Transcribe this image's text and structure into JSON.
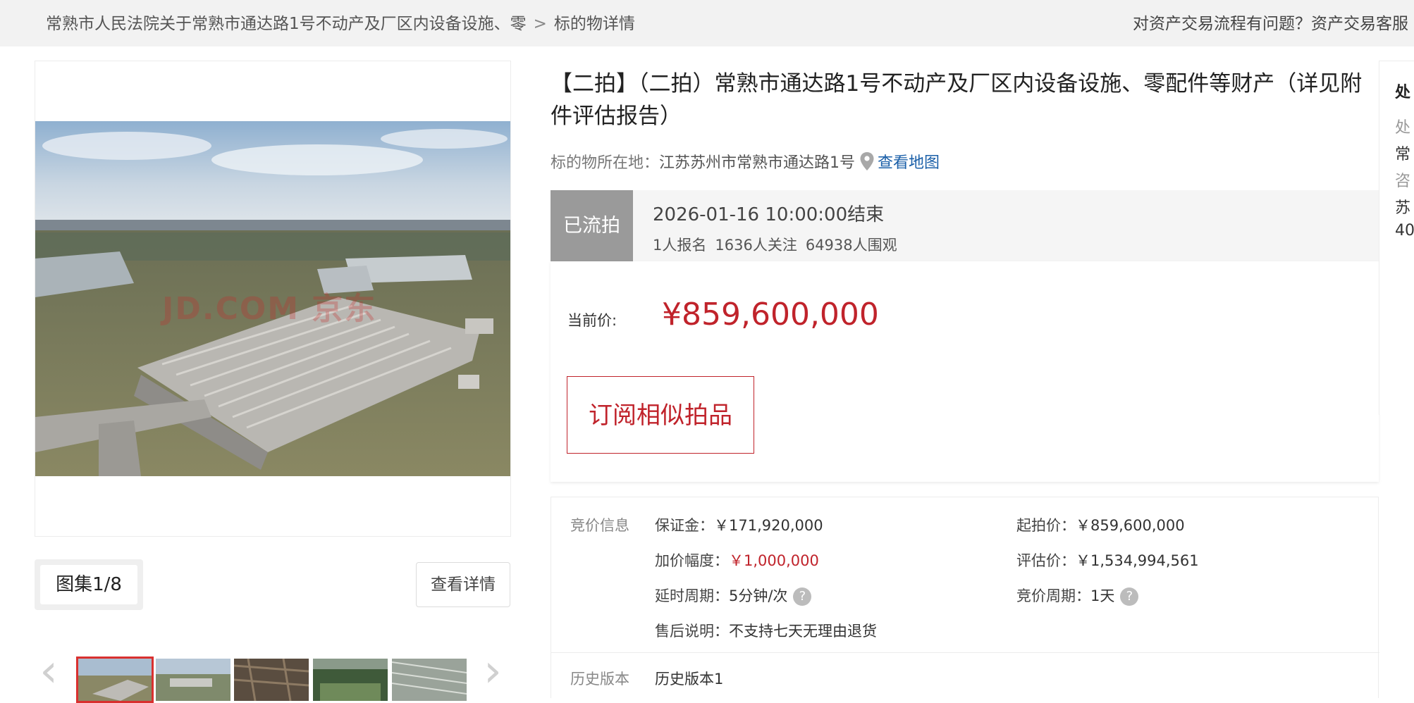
{
  "breadcrumb": {
    "court": "常熟市人民法院关于常熟市通达路1号不动产及厂区内设备设施、零",
    "separator": ">",
    "current": "标的物详情"
  },
  "help_text": "对资产交易流程有问题？资产交易客服",
  "gallery": {
    "watermark": "JD.COM 京东",
    "album_label": "图集1/8",
    "detail_button": "查看详情",
    "prev_icon": "chevron-left-icon",
    "next_icon": "chevron-right-icon"
  },
  "item": {
    "title": "【二拍】（二拍）常熟市通达路1号不动产及厂区内设备设施、零配件等财产（详见附件评估报告）",
    "location_label": "标的物所在地：",
    "location": "江苏苏州市常熟市通达路1号",
    "map_link": "查看地图"
  },
  "status": {
    "badge": "已流拍",
    "end_time": "2026-01-16 10:00:00结束",
    "signups": "1人报名",
    "followers": "1636人关注",
    "viewers": "64938人围观"
  },
  "price": {
    "label": "当前价:",
    "value": "¥859,600,000",
    "subscribe_button": "订阅相似拍品"
  },
  "bid_info": {
    "section_label": "竞价信息",
    "deposit_label": "保证金：",
    "deposit_value": "￥171,920,000",
    "start_price_label": "起拍价：",
    "start_price_value": "￥859,600,000",
    "increment_label": "加价幅度：",
    "increment_value": "￥1,000,000",
    "appraisal_label": "评估价：",
    "appraisal_value": "￥1,534,994,561",
    "delay_label": "延时周期：",
    "delay_value": "5分钟/次",
    "bid_period_label": "竞价周期：",
    "bid_period_value": "1天",
    "after_sale_label": "售后说明：",
    "after_sale_value": "不支持七天无理由退货",
    "help_mark": "?"
  },
  "history": {
    "label": "历史版本",
    "value": "历史版本1"
  },
  "right_card": {
    "line1": "处",
    "line2": "处",
    "line3": "常",
    "line4": "咨",
    "line5": "苏",
    "line6": "40"
  },
  "colors": {
    "accent_red": "#c0232b",
    "link_blue": "#1a5fa8",
    "badge_gray": "#9a9a9a"
  }
}
